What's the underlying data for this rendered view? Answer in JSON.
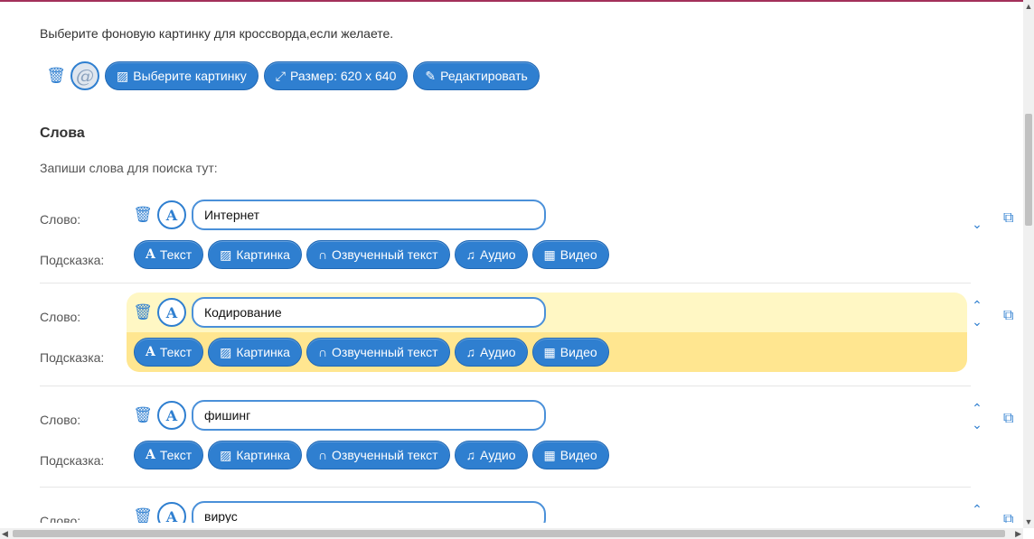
{
  "background": {
    "intro": "Выберите фоновую картинку для кроссворда,если желаете.",
    "choose_image_label": "Выберите картинку",
    "size_label": "Размер: 620 x 640",
    "edit_label": "Редактировать",
    "at_glyph": "@"
  },
  "words_section": {
    "title": "Слова",
    "subtitle": "Запиши слова для поиска тут:",
    "word_label": "Слово:",
    "hint_label": "Подсказка:",
    "a_glyph": "A",
    "hint_buttons": {
      "text": "Текст",
      "image": "Картинка",
      "voiced": "Озвученный текст",
      "audio": "Аудио",
      "video": "Видео"
    },
    "entries": [
      {
        "word": "Интернет",
        "highlighted": false
      },
      {
        "word": "Кодирование",
        "highlighted": true
      },
      {
        "word": "фишинг",
        "highlighted": false
      },
      {
        "word": "вирус",
        "highlighted": false
      }
    ]
  },
  "colors": {
    "accent": "#2f7fd0",
    "highlight_top": "#fff7c4",
    "highlight_bottom": "#ffe690",
    "top_border": "#a3305a"
  },
  "icons": [
    "trash-icon",
    "image-icon",
    "resize-icon",
    "edit-icon",
    "audio-icon",
    "music-icon",
    "film-icon",
    "chevron-up-icon",
    "chevron-down-icon",
    "copy-icon"
  ]
}
